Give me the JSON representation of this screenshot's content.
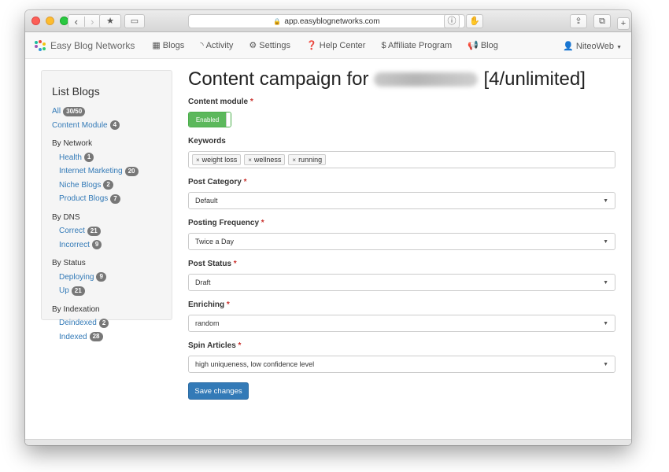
{
  "browser": {
    "url": "app.easyblognetworks.com"
  },
  "navbar": {
    "brand": "Easy Blog Networks",
    "items": [
      {
        "label": "Blogs",
        "icon": "grid-icon"
      },
      {
        "label": "Activity",
        "icon": "rss-icon"
      },
      {
        "label": "Settings",
        "icon": "gear-icon"
      },
      {
        "label": "Help Center",
        "icon": "question-icon"
      },
      {
        "label": "$ Affiliate Program",
        "icon": ""
      },
      {
        "label": "Blog",
        "icon": "bullhorn-icon"
      }
    ],
    "user": "NiteoWeb"
  },
  "sidebar": {
    "title": "List Blogs",
    "all": {
      "label": "All",
      "count": "30/50"
    },
    "content_module": {
      "label": "Content Module",
      "count": "4"
    },
    "groups": [
      {
        "heading": "By Network",
        "items": [
          {
            "label": "Health",
            "count": "1"
          },
          {
            "label": "Internet Marketing",
            "count": "20"
          },
          {
            "label": "Niche Blogs",
            "count": "2"
          },
          {
            "label": "Product Blogs",
            "count": "7"
          }
        ]
      },
      {
        "heading": "By DNS",
        "items": [
          {
            "label": "Correct",
            "count": "21"
          },
          {
            "label": "Incorrect",
            "count": "9"
          }
        ]
      },
      {
        "heading": "By Status",
        "items": [
          {
            "label": "Deploying",
            "count": "9"
          },
          {
            "label": "Up",
            "count": "21"
          }
        ]
      },
      {
        "heading": "By Indexation",
        "items": [
          {
            "label": "Deindexed",
            "count": "2"
          },
          {
            "label": "Indexed",
            "count": "28"
          }
        ]
      }
    ]
  },
  "main": {
    "title_prefix": "Content campaign for",
    "title_suffix": "[4/unlimited]",
    "content_module": {
      "label": "Content module",
      "toggle_label": "Enabled"
    },
    "keywords": {
      "label": "Keywords",
      "tags": [
        "weight loss",
        "wellness",
        "running"
      ]
    },
    "post_category": {
      "label": "Post Category",
      "value": "Default"
    },
    "posting_frequency": {
      "label": "Posting Frequency",
      "value": "Twice a Day"
    },
    "post_status": {
      "label": "Post Status",
      "value": "Draft"
    },
    "enriching": {
      "label": "Enriching",
      "value": "random"
    },
    "spin_articles": {
      "label": "Spin Articles",
      "value": "high uniqueness, low confidence level"
    },
    "save_label": "Save changes",
    "required_mark": "*"
  }
}
